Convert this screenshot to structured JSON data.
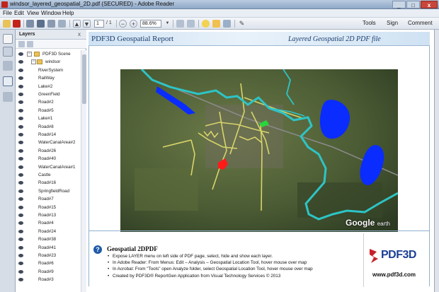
{
  "window": {
    "title": "windsor_layered_geospatial_2D.pdf (SECURED) - Adobe Reader",
    "minimize_glyph": "_",
    "maximize_glyph": "□",
    "close_glyph": "x"
  },
  "menu": [
    "File",
    "Edit",
    "View",
    "Window",
    "Help"
  ],
  "toolbar": {
    "page_current": "1",
    "page_total": "/ 1",
    "zoom": "88.6%",
    "tools_label": "Tools",
    "sign_label": "Sign",
    "comment_label": "Comment"
  },
  "layers_panel": {
    "title": "Layers",
    "close_glyph": "x",
    "root": "PDF3D Scene",
    "folder": "windsor",
    "items": [
      "RiverSystem",
      "RailWay",
      "Lake#2",
      "GreenField",
      "Road#2",
      "Road#5",
      "Lake#1",
      "Road#8",
      "Road#14",
      "WaterCanalArea#2",
      "Road#26",
      "Road#40",
      "WaterCanalArea#1",
      "Castle",
      "Road#16",
      "SpringfieldRoad",
      "Road#7",
      "Road#15",
      "Road#13",
      "Road#4",
      "Road#24",
      "Road#38",
      "Road#41",
      "Road#23",
      "Road#6",
      "Road#9",
      "Road#3"
    ]
  },
  "page": {
    "banner_left": "PDF3D Geospatial Report",
    "banner_right": "Layered Geospatial 2D PDF file",
    "map_watermark": "Google",
    "map_watermark_sub": "earth",
    "info_title": "Geospatial 2DPDF",
    "bullets": [
      "Expose LAYER menu on left side of PDF page, select, hide and show each layer.",
      "In Adobe Reader:  From Menus: Edit – Analysis – Geospatial Location Tool, hover mouse over map",
      "In Acrobat: From \"Tools\" open Analyze folder, select Geospatial Location Tool, hover mouse over map",
      "Created by PDF3D® ReportGen Application from Visual Technology Services  © 2013"
    ],
    "logo_brand": "PDF3D",
    "logo_url": "www.pdf3d.com"
  },
  "colors": {
    "river": "#2ec4c6",
    "lake": "#0a2cff",
    "road": "#d9d46a",
    "castle": "#ff1a1a",
    "greenfield": "#27d83a",
    "brand": "#1c3f94"
  }
}
